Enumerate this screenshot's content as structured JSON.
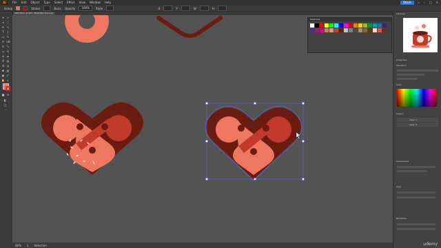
{
  "app": {
    "logo": "Ai",
    "share_label": "Share"
  },
  "menu": [
    "File",
    "Edit",
    "Object",
    "Type",
    "Select",
    "Effect",
    "View",
    "Window",
    "Help"
  ],
  "control": {
    "object": "Group",
    "stroke_label": "Stroke",
    "basic_label": "Basic",
    "opacity_label": "Opacity",
    "opacity_value": "100%",
    "style_label": "Style",
    "x_label": "X",
    "y_label": "Y",
    "w_label": "W",
    "h_label": "H"
  },
  "document_tab": "PRETZELS @ 66% (RGB/GPU Preview)",
  "status": {
    "zoom": "66%",
    "artboard": "1",
    "tool": "Selection"
  },
  "swatches": {
    "title": "Swatches",
    "colors": [
      "#ffffff",
      "#000000",
      "#ff0000",
      "#ffff00",
      "#00ff00",
      "#00ffff",
      "#0000ff",
      "#ff00ff",
      "#e4001b",
      "#ef7d00",
      "#f8d100",
      "#95c11f",
      "#009640",
      "#00a19a",
      "#1d71b8",
      "#312783",
      "#662483",
      "#951b81",
      "#e6007e",
      "#c77b61",
      "#e9967a",
      "#b5492f",
      "#6b1c10",
      "#c0c0c0",
      "#808080",
      "#4d4d4d",
      "#b38d5a",
      "#8c6239",
      "#603813",
      "#f5d6c8",
      "#d9534f",
      "#7a2914"
    ]
  },
  "right_panel": {
    "properties_title": "Properties",
    "layers_title": "Layers",
    "libraries_title": "Libraries",
    "transform_title": "Transform",
    "appearance_title": "Appearance",
    "align_title": "Align",
    "pathfinder_title": "Pathfinder",
    "color_title": "Color",
    "layers": [
      "Layer 1",
      "Layer 2"
    ]
  },
  "watermark": "udemy",
  "colors": {
    "salmon": "#ee7760",
    "red": "#c23a2b",
    "outline": "#6b1c10",
    "sesame": "#f7c9b5"
  }
}
